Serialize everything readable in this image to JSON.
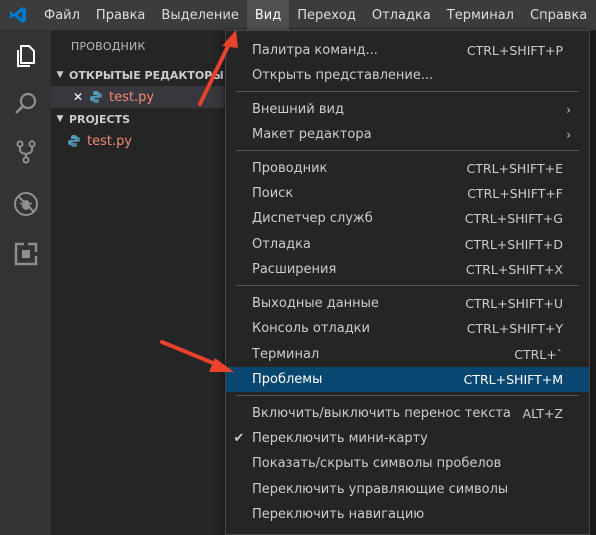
{
  "menubar": {
    "items": [
      "Файл",
      "Правка",
      "Выделение",
      "Вид",
      "Переход",
      "Отладка",
      "Терминал",
      "Справка"
    ],
    "active_index": 3
  },
  "sidebar": {
    "title": "ПРОВОДНИК",
    "open_editors_header": "ОТКРЫТЫЕ РЕДАКТОРЫ",
    "open_editors_file": "test.py",
    "projects_header": "PROJECTS",
    "projects_file": "test.py"
  },
  "view_menu": {
    "items": [
      {
        "label": "Палитра команд...",
        "shortcut": "CTRL+SHIFT+P"
      },
      {
        "label": "Открыть представление...",
        "shortcut": ""
      },
      {
        "label": "Внешний вид",
        "shortcut": "",
        "submenu": true
      },
      {
        "label": "Макет редактора",
        "shortcut": "",
        "submenu": true
      },
      {
        "label": "Проводник",
        "shortcut": "CTRL+SHIFT+E"
      },
      {
        "label": "Поиск",
        "shortcut": "CTRL+SHIFT+F"
      },
      {
        "label": "Диспетчер служб",
        "shortcut": "CTRL+SHIFT+G"
      },
      {
        "label": "Отладка",
        "shortcut": "CTRL+SHIFT+D"
      },
      {
        "label": "Расширения",
        "shortcut": "CTRL+SHIFT+X"
      },
      {
        "label": "Выходные данные",
        "shortcut": "CTRL+SHIFT+U"
      },
      {
        "label": "Консоль отладки",
        "shortcut": "CTRL+SHIFT+Y"
      },
      {
        "label": "Терминал",
        "shortcut": "CTRL+`"
      },
      {
        "label": "Проблемы",
        "shortcut": "CTRL+SHIFT+M",
        "highlighted": true
      },
      {
        "label": "Включить/выключить перенос текста",
        "shortcut": "ALT+Z"
      },
      {
        "label": "Переключить мини-карту",
        "shortcut": "",
        "checked": true
      },
      {
        "label": "Показать/скрыть символы пробелов",
        "shortcut": ""
      },
      {
        "label": "Переключить управляющие символы",
        "shortcut": ""
      },
      {
        "label": "Переключить навигацию",
        "shortcut": ""
      }
    ]
  },
  "colors": {
    "menubar_bg": "#3c3c3c",
    "activitybar_bg": "#333333",
    "sidebar_bg": "#252526",
    "menu_highlight": "#094771",
    "file_modified": "#f48771",
    "annotation_arrow": "#e8412c",
    "vscode_blue": "#007acc"
  },
  "icons": [
    "vscode-logo-icon",
    "explorer-icon",
    "search-icon",
    "source-control-icon",
    "debug-icon",
    "extensions-icon",
    "python-file-icon",
    "close-icon",
    "chevron-right-icon",
    "checkmark-icon"
  ]
}
